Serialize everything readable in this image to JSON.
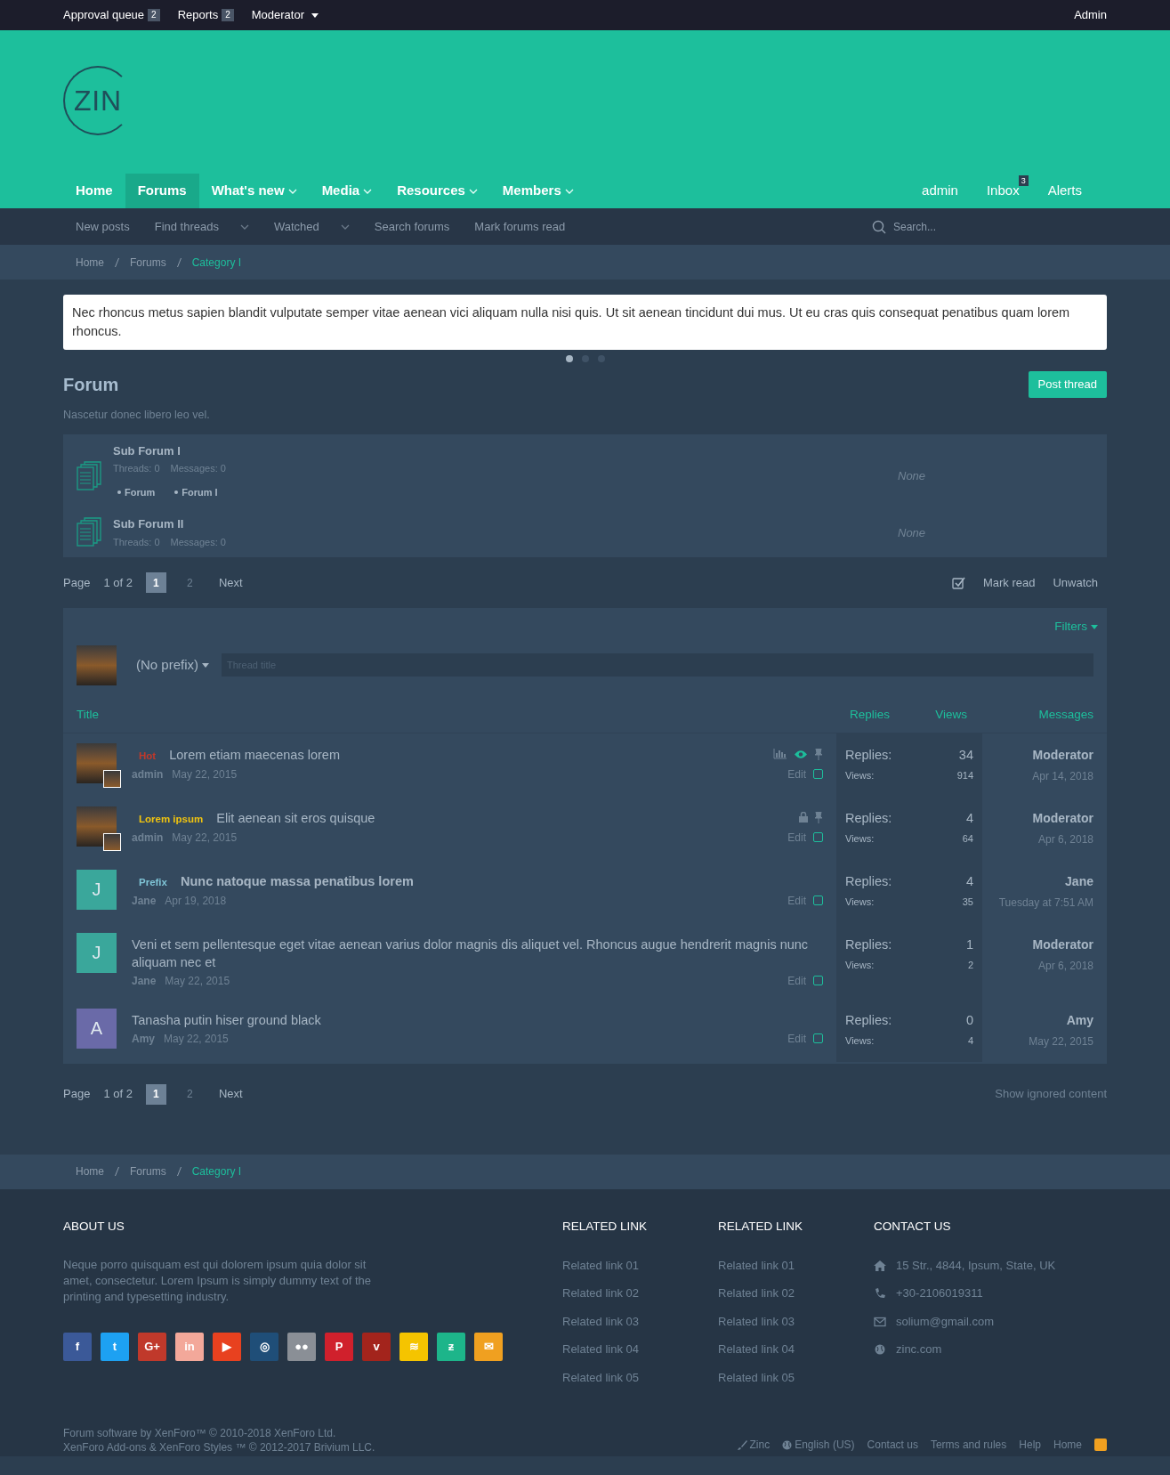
{
  "top_bar": {
    "left": [
      {
        "label": "Approval queue",
        "badge": "2"
      },
      {
        "label": "Reports",
        "badge": "2"
      },
      {
        "label": "Moderator",
        "caret": true
      }
    ],
    "right": "Admin"
  },
  "logo": {
    "text": "ZIN"
  },
  "nav": {
    "tabs": [
      {
        "label": "Home",
        "selected": false,
        "dropdown": false
      },
      {
        "label": "Forums",
        "selected": true,
        "dropdown": false
      },
      {
        "label": "What's new",
        "selected": false,
        "dropdown": true
      },
      {
        "label": "Media",
        "selected": false,
        "dropdown": true
      },
      {
        "label": "Resources",
        "selected": false,
        "dropdown": true
      },
      {
        "label": "Members",
        "selected": false,
        "dropdown": true
      }
    ],
    "user": [
      {
        "label": "admin"
      },
      {
        "label": "Inbox",
        "badge": "3"
      },
      {
        "label": "Alerts"
      }
    ]
  },
  "sub_nav": {
    "items": [
      {
        "label": "New posts",
        "dropdown": false
      },
      {
        "label": "Find threads",
        "dropdown": true
      },
      {
        "label": "Watched",
        "dropdown": true
      },
      {
        "label": "Search forums",
        "dropdown": false
      },
      {
        "label": "Mark forums read",
        "dropdown": false
      }
    ],
    "search": {
      "placeholder": "Search..."
    }
  },
  "breadcrumb": [
    {
      "label": "Home",
      "current": false
    },
    {
      "label": "Forums",
      "current": false
    },
    {
      "label": "Category I",
      "current": true
    }
  ],
  "notice": {
    "text": "Nec rhoncus metus sapien blandit vulputate semper vitae aenean vici aliquam nulla nisi quis. Ut sit aenean tincidunt dui mus. Ut eu cras quis consequat penatibus quam lorem rhoncus.",
    "dots": [
      {
        "selected": true
      },
      {
        "selected": false
      },
      {
        "selected": false
      }
    ]
  },
  "forum": {
    "title": "Forum",
    "description": "Nascetur donec libero leo vel.",
    "post_button": "Post thread"
  },
  "sub_forums": [
    {
      "name": "Sub Forum I",
      "threads_label": "Threads:",
      "threads": "0",
      "messages_label": "Messages:",
      "messages": "0",
      "links": [
        "Forum",
        "Forum I"
      ],
      "last_post": "None"
    },
    {
      "name": "Sub Forum II",
      "threads_label": "Threads:",
      "threads": "0",
      "messages_label": "Messages:",
      "messages": "0",
      "last_post": "None"
    }
  ],
  "pagination_top": {
    "label": "Page",
    "range": "1 of 2",
    "pages": [
      {
        "label": "1",
        "selected": true
      },
      {
        "label": "2",
        "selected": false
      }
    ],
    "next": "Next",
    "actions": [
      "Mark read",
      "Unwatch"
    ]
  },
  "thread_list": {
    "filters": "Filters",
    "prefix_select": "(No prefix)",
    "title_field": {
      "placeholder": "Thread title"
    },
    "columns": [
      "Title",
      "Replies",
      "Views",
      "Messages"
    ],
    "threads": [
      {
        "avatar": {
          "kind": "photo"
        },
        "prefix": {
          "text": "Hot",
          "color": "#c0392b"
        },
        "title": "Lorem etiam maecenas lorem",
        "bold": false,
        "author": "admin",
        "date": "May 22, 2015",
        "poll": true,
        "watched": true,
        "sticky": true,
        "edit": "Edit",
        "checked": false,
        "replies_label": "Replies:",
        "replies": "34",
        "views_label": "Views:",
        "views": "914",
        "last_user": "Moderator",
        "last_date": "Apr 14, 2018"
      },
      {
        "avatar": {
          "kind": "photo"
        },
        "prefix": {
          "text": "Lorem ipsum",
          "color": "#f1c40f"
        },
        "title": "Elit aenean sit eros quisque",
        "bold": false,
        "author": "admin",
        "date": "May 22, 2015",
        "locked": true,
        "sticky": true,
        "edit": "Edit",
        "checked": false,
        "replies_label": "Replies:",
        "replies": "4",
        "views_label": "Views:",
        "views": "64",
        "last_user": "Moderator",
        "last_date": "Apr 6, 2018"
      },
      {
        "avatar": {
          "kind": "letter",
          "letter": "J",
          "color": "#3aa79b"
        },
        "prefix": {
          "text": "Prefix",
          "color": "#7fc4d6"
        },
        "title": "Nunc natoque massa penatibus lorem",
        "bold": true,
        "author": "Jane",
        "date": "Apr 19, 2018",
        "edit": "Edit",
        "checked": false,
        "replies_label": "Replies:",
        "replies": "4",
        "views_label": "Views:",
        "views": "35",
        "last_user": "Jane",
        "last_date": "Tuesday at 7:51 AM"
      },
      {
        "avatar": {
          "kind": "letter",
          "letter": "J",
          "color": "#3aa79b"
        },
        "title": "Veni et sem pellentesque eget vitae aenean varius dolor magnis dis aliquet vel. Rhoncus augue hendrerit magnis nunc aliquam nec et",
        "bold": false,
        "author": "Jane",
        "date": "May 22, 2015",
        "edit": "Edit",
        "checked": false,
        "replies_label": "Replies:",
        "replies": "1",
        "views_label": "Views:",
        "views": "2",
        "last_user": "Moderator",
        "last_date": "Apr 6, 2018"
      },
      {
        "avatar": {
          "kind": "letter",
          "letter": "A",
          "color": "#6a6aa8"
        },
        "title": "Tanasha putin hiser ground black",
        "bold": false,
        "author": "Amy",
        "date": "May 22, 2015",
        "edit": "Edit",
        "checked": false,
        "replies_label": "Replies:",
        "replies": "0",
        "views_label": "Views:",
        "views": "4",
        "last_user": "Amy",
        "last_date": "May 22, 2015"
      }
    ]
  },
  "pagination_bottom": {
    "label": "Page",
    "range": "1 of 2",
    "pages": [
      {
        "label": "1",
        "selected": true
      },
      {
        "label": "2",
        "selected": false
      }
    ],
    "next": "Next",
    "show_ignored": "Show ignored content"
  },
  "breadcrumb_bottom": [
    {
      "label": "Home",
      "current": false
    },
    {
      "label": "Forums",
      "current": false
    },
    {
      "label": "Category I",
      "current": true
    }
  ],
  "footer": {
    "about": {
      "heading": "ABOUT US",
      "text": "Neque porro quisquam est qui dolorem ipsum quia dolor sit amet, consectetur. Lorem Ipsum is simply dummy text of the printing and typesetting industry."
    },
    "social": [
      {
        "color": "#3b5998",
        "glyph": "f"
      },
      {
        "color": "#1da1f2",
        "glyph": "t"
      },
      {
        "color": "#c0392b",
        "glyph": "G+"
      },
      {
        "color": "#f3a89a",
        "glyph": "in"
      },
      {
        "color": "#e8411f",
        "glyph": "▶"
      },
      {
        "color": "#1f4e78",
        "glyph": "◎"
      },
      {
        "color": "#8a8f96",
        "glyph": "●●"
      },
      {
        "color": "#d0202c",
        "glyph": "P"
      },
      {
        "color": "#a3241c",
        "glyph": "v"
      },
      {
        "color": "#f5c400",
        "glyph": "≋"
      },
      {
        "color": "#1db58a",
        "glyph": "ƶ"
      },
      {
        "color": "#f0a020",
        "glyph": "✉"
      }
    ],
    "related": [
      {
        "heading": "RELATED LINK",
        "links": [
          "Related link 01",
          "Related link 02",
          "Related link 03",
          "Related link 04",
          "Related link 05"
        ]
      },
      {
        "heading": "RELATED LINK",
        "links": [
          "Related link 01",
          "Related link 02",
          "Related link 03",
          "Related link 04",
          "Related link 05"
        ]
      }
    ],
    "contact": {
      "heading": "CONTACT US",
      "items": [
        {
          "kind": "address",
          "text": "15 Str., 4844, Ipsum, State, UK"
        },
        {
          "kind": "phone",
          "text": "+30-2106019311"
        },
        {
          "kind": "email",
          "text": "solium@gmail.com"
        },
        {
          "kind": "web",
          "text": "zinc.com"
        }
      ]
    },
    "copyright": [
      "Forum software by XenForo™ © 2010-2018 XenForo Ltd.",
      "XenForo Add-ons & XenForo Styles ™ © 2012-2017 Brivium LLC."
    ],
    "links": [
      {
        "kind": "style",
        "label": "Zinc"
      },
      {
        "kind": "language",
        "label": "English (US)"
      },
      {
        "kind": "plain",
        "label": "Contact us"
      },
      {
        "kind": "plain",
        "label": "Terms and rules"
      },
      {
        "kind": "plain",
        "label": "Help"
      },
      {
        "kind": "plain",
        "label": "Home"
      },
      {
        "kind": "rss"
      }
    ]
  }
}
